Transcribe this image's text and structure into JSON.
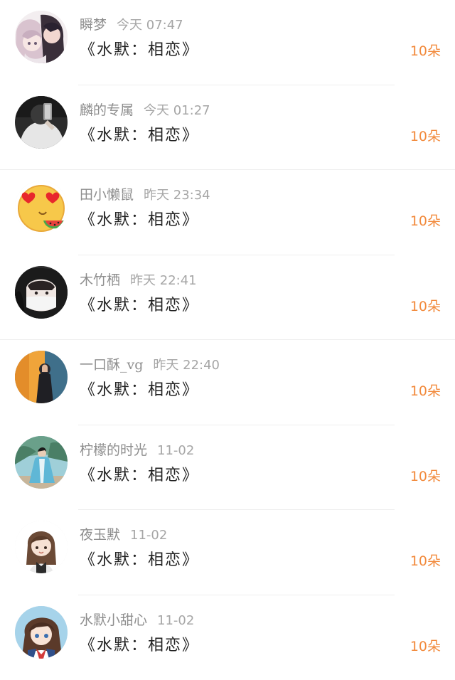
{
  "colors": {
    "name": "#8e8e8e",
    "time": "#a6a6a6",
    "gift": "#222222",
    "amount": "#f28a3c",
    "divider": "#eeeeee"
  },
  "records": [
    {
      "name": "瞬梦",
      "time": "今天 07:47",
      "gift": "《水默：相恋》",
      "amount": "10朵",
      "avatar": "couple-anime-avatar-icon"
    },
    {
      "name": "麟的专属",
      "time": "今天 01:27",
      "gift": "《水默：相恋》",
      "amount": "10朵",
      "avatar": "selfie-dark-avatar-icon"
    },
    {
      "name": "田小懒鼠",
      "time": "昨天 23:34",
      "gift": "《水默：相恋》",
      "amount": "10朵",
      "avatar": "heart-eyes-emoji-avatar-icon"
    },
    {
      "name": "木竹栖",
      "time": "昨天 22:41",
      "gift": "《水默：相恋》",
      "amount": "10朵",
      "avatar": "masked-girl-avatar-icon"
    },
    {
      "name": "一口酥_vg",
      "time": "昨天 22:40",
      "gift": "《水默：相恋》",
      "amount": "10朵",
      "avatar": "silhouette-orange-avatar-icon"
    },
    {
      "name": "柠檬的时光",
      "time": "11-02",
      "gift": "《水默：相恋》",
      "amount": "10朵",
      "avatar": "costume-figure-avatar-icon"
    },
    {
      "name": "夜玉默",
      "time": "11-02",
      "gift": "《水默：相恋》",
      "amount": "10朵",
      "avatar": "drawn-girl-avatar-icon"
    },
    {
      "name": "水默小甜心",
      "time": "11-02",
      "gift": "《水默：相恋》",
      "amount": "10朵",
      "avatar": "anime-schoolgirl-avatar-icon"
    }
  ]
}
